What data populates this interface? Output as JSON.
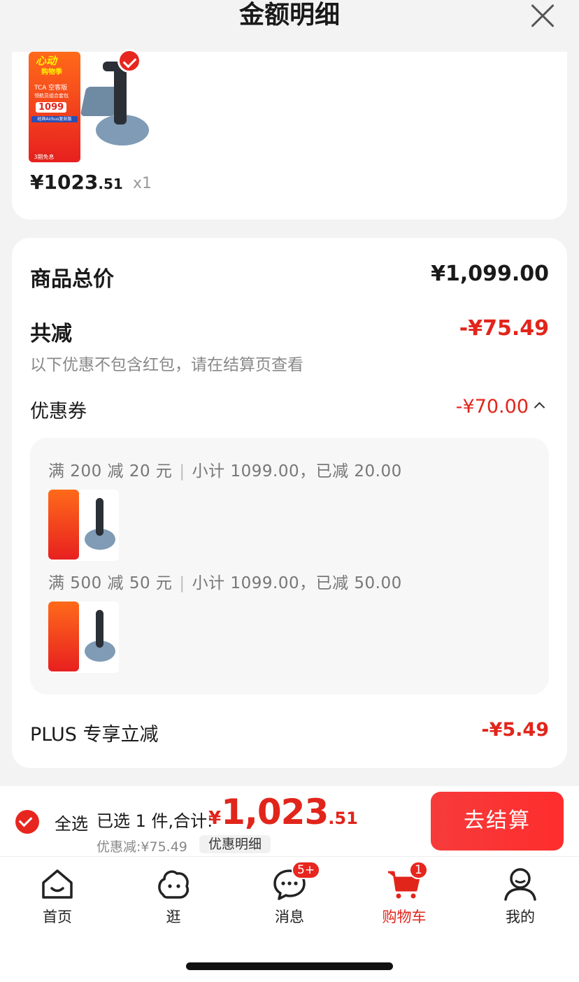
{
  "header": {
    "title": "金额明细"
  },
  "product": {
    "poster": {
      "line1": "心动",
      "line2": "购物季",
      "name": "TCA 空客版",
      "subtitle": "领航员组合套包",
      "price": "1099",
      "band": "经典Airbus复刻版",
      "tag": "3期免息"
    },
    "price_main": "¥1023",
    "price_cents": ".51",
    "qty": "x1"
  },
  "summary": {
    "total_label": "商品总价",
    "total_value": "¥1,099.00",
    "reduce_label": "共减",
    "reduce_value": "-¥75.49",
    "note": "以下优惠不包含红包，请在结算页查看",
    "coupon_label": "优惠券",
    "coupon_value": "-¥70.00",
    "coupons": [
      {
        "rule": "满 200 减 20 元",
        "detail": "小计 1099.00，已减 20.00"
      },
      {
        "rule": "满 500 减 50 元",
        "detail": "小计 1099.00，已减 50.00"
      }
    ],
    "plus_label": "PLUS 专享立减",
    "plus_value": "-¥5.49"
  },
  "bottom_bar": {
    "select_all": "全选",
    "selected_text": "已选 1 件,合计:",
    "currency": "¥",
    "total_main": "1,023",
    "total_cents": ".51",
    "discount_text": "优惠减:¥75.49",
    "detail_button": "优惠明细",
    "checkout_button": "去结算"
  },
  "tabbar": {
    "items": [
      {
        "label": "首页",
        "icon": "home-icon"
      },
      {
        "label": "逛",
        "icon": "browse-icon"
      },
      {
        "label": "消息",
        "icon": "message-icon",
        "badge": "5+"
      },
      {
        "label": "购物车",
        "icon": "cart-icon",
        "badge": "1",
        "active": true
      },
      {
        "label": "我的",
        "icon": "profile-icon"
      }
    ]
  },
  "colors": {
    "accent": "#e1251b",
    "background": "#f3f3f3"
  }
}
